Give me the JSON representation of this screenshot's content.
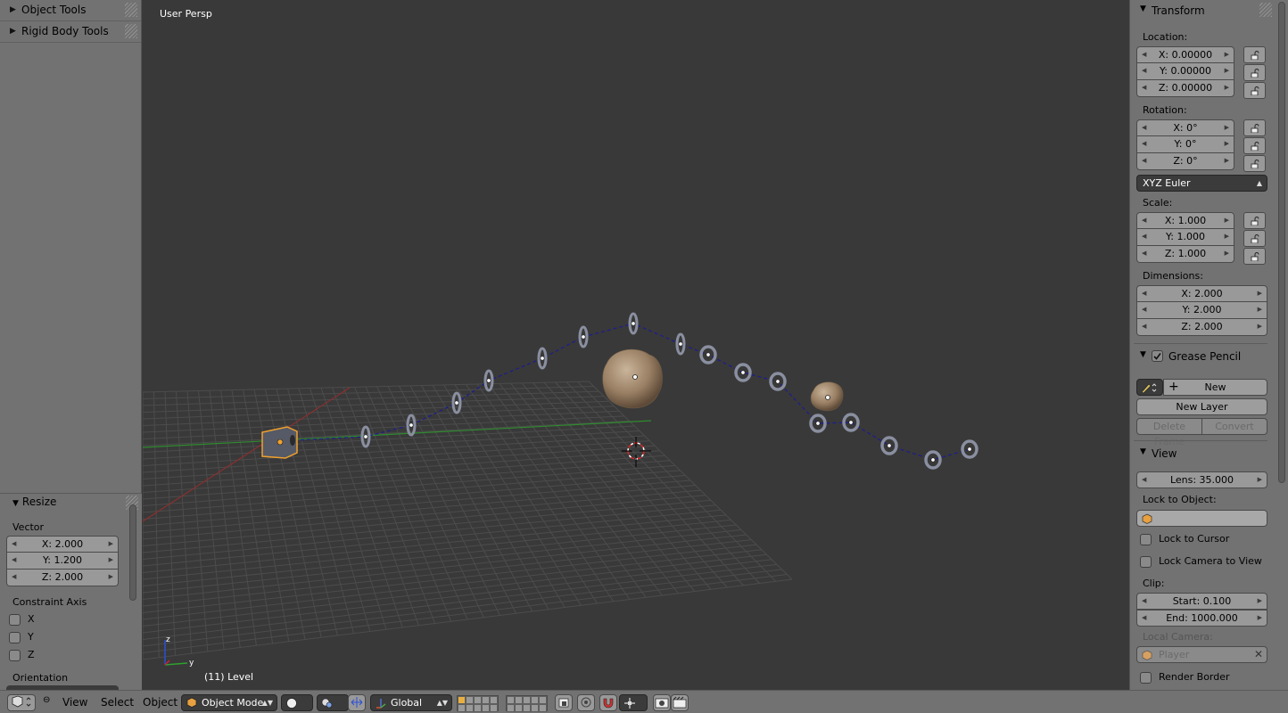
{
  "left_shelf": {
    "panels": [
      {
        "label": "Object Tools"
      },
      {
        "label": "Rigid Body Tools"
      }
    ],
    "operator": {
      "title": "Resize",
      "vector_label": "Vector",
      "vector": [
        "X: 2.000",
        "Y: 1.200",
        "Z: 2.000"
      ],
      "constraint_label": "Constraint Axis",
      "constraint_axes": [
        "X",
        "Y",
        "Z"
      ],
      "orientation_label": "Orientation"
    }
  },
  "viewport": {
    "title": "User Persp",
    "frame_label": "(11) Level",
    "axis_labels": {
      "z": "z",
      "y": "y"
    }
  },
  "right_panel": {
    "transform": {
      "title": "Transform",
      "location_label": "Location:",
      "location": [
        "X: 0.00000",
        "Y: 0.00000",
        "Z: 0.00000"
      ],
      "rotation_label": "Rotation:",
      "rotation": [
        "X: 0°",
        "Y: 0°",
        "Z: 0°"
      ],
      "rotation_mode": "XYZ Euler",
      "scale_label": "Scale:",
      "scale": [
        "X: 1.000",
        "Y: 1.000",
        "Z: 1.000"
      ],
      "dimensions_label": "Dimensions:",
      "dimensions": [
        "X: 2.000",
        "Y: 2.000",
        "Z: 2.000"
      ]
    },
    "grease_pencil": {
      "title": "Grease Pencil",
      "enabled": true,
      "new_label": "New",
      "new_layer_label": "New Layer",
      "delete_frame_label": "Delete Frame",
      "convert_label": "Convert"
    },
    "view": {
      "title": "View",
      "lens": "Lens: 35.000",
      "lock_to_object_label": "Lock to Object:",
      "lock_to_cursor": "Lock to Cursor",
      "lock_camera_to_view": "Lock Camera to View",
      "clip_label": "Clip:",
      "clip_start": "Start: 0.100",
      "clip_end": "End: 1000.000",
      "local_camera_label": "Local Camera:",
      "local_camera_value": "Player",
      "render_border": "Render Border"
    }
  },
  "bottom_bar": {
    "menus": [
      "View",
      "Select",
      "Object"
    ],
    "mode": "Object Mode",
    "orientation": "Global"
  },
  "colors": {
    "panel_bg": "#727272",
    "viewport_bg": "#393939",
    "field_bg": "#999999",
    "dropdown_bg": "#3b3b3b",
    "selection_orange": "#f0a030",
    "path_blue": "#1e1e8c"
  }
}
